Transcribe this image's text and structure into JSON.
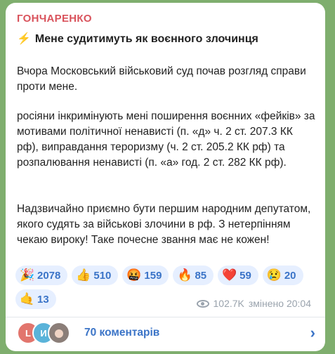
{
  "post": {
    "channel_name": "ГОНЧАРЕНКО",
    "title_icon": "⚡",
    "title": "Мене судитимуть як воєнного злочинця",
    "paragraphs": [
      "Вчора Московський військовий суд почав розгляд справи проти мене.",
      "росіяни інкримінують мені поширення воєнних «фейків» за мотивами політичної ненависті (п. «д» ч. 2 ст. 207.3 КК рф), виправдання тероризму (ч. 2 ст. 205.2 КК рф) та розпалювання ненависті (п. «а» год. 2 ст. 282 КК рф).",
      "Надзвичайно приємно бути першим народним депутатом, якого судять за військові злочини в рф. З нетерпінням чекаю вироку! Таке почесне звання має не кожен!"
    ]
  },
  "reactions": [
    {
      "emoji": "🎉",
      "count": "2078",
      "icon": "party-popper-icon"
    },
    {
      "emoji": "👍",
      "count": "510",
      "icon": "thumbs-up-icon"
    },
    {
      "emoji": "🤬",
      "count": "159",
      "icon": "swearing-face-icon"
    },
    {
      "emoji": "🔥",
      "count": "85",
      "icon": "fire-icon"
    },
    {
      "emoji": "❤️",
      "count": "59",
      "icon": "heart-icon"
    },
    {
      "emoji": "😢",
      "count": "20",
      "icon": "crying-face-icon"
    },
    {
      "emoji": "🤙",
      "count": "13",
      "icon": "call-me-hand-icon"
    }
  ],
  "meta": {
    "views": "102.7K",
    "edited_label": "змінено 20:04"
  },
  "comments": {
    "label": "70 коментарів",
    "avatars": [
      "L",
      "И"
    ]
  },
  "colors": {
    "channel_name": "#d9535c",
    "link_accent": "#3b74c7",
    "reaction_bg": "#e6efff",
    "chat_background": "#7fae6e"
  }
}
